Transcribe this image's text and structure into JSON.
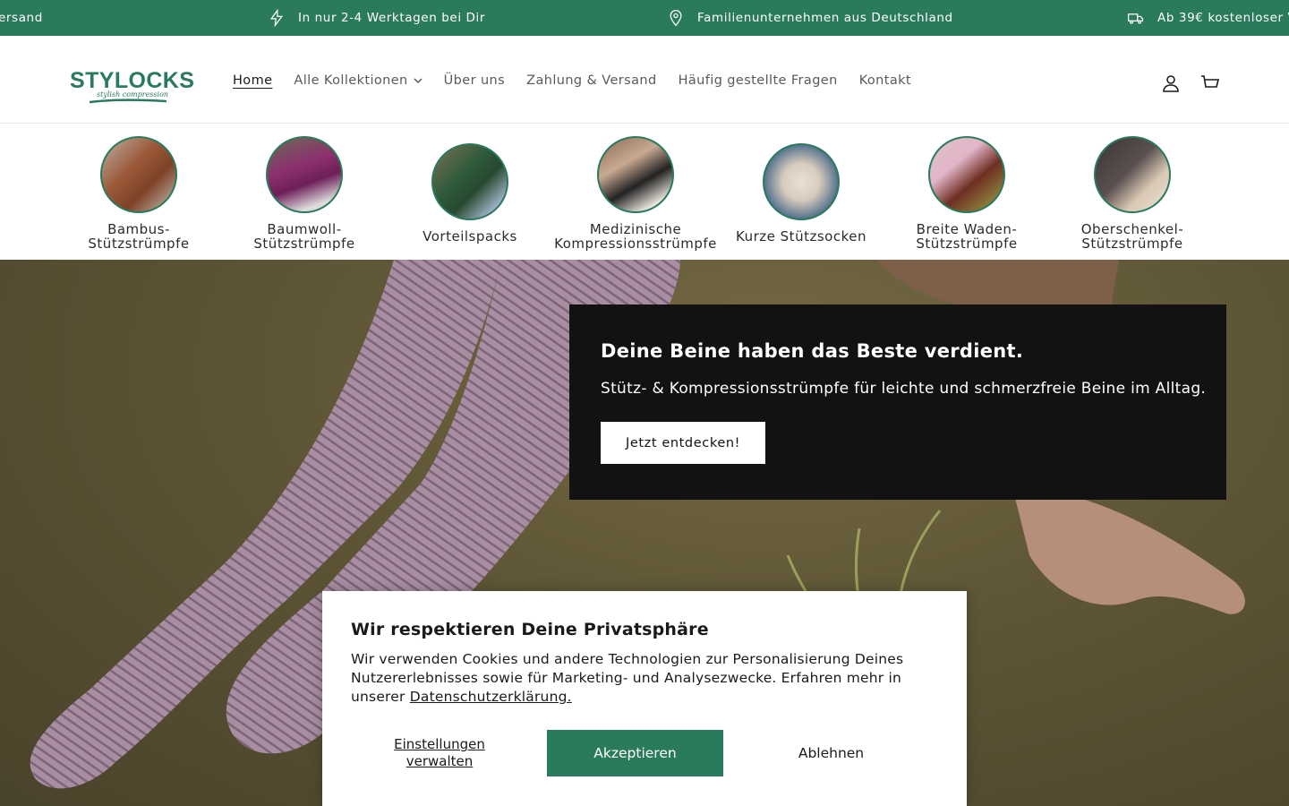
{
  "announcement": {
    "items": [
      {
        "icon": "truck-icon",
        "text": "ersand"
      },
      {
        "icon": "lightning-icon",
        "text": "In nur 2-4 Werktagen bei Dir"
      },
      {
        "icon": "map-pin-icon",
        "text": "Familienunternehmen aus Deutschland"
      },
      {
        "icon": "truck-icon",
        "text": "Ab 39€ kostenloser V"
      }
    ]
  },
  "header": {
    "logo_text": "STYLOCKS",
    "logo_tagline": "stylish compression",
    "nav": [
      {
        "label": "Home",
        "active": true
      },
      {
        "label": "Alle Kollektionen",
        "has_dropdown": true
      },
      {
        "label": "Über uns"
      },
      {
        "label": "Zahlung & Versand"
      },
      {
        "label": "Häufig gestellte Fragen"
      },
      {
        "label": "Kontakt"
      }
    ],
    "icons": [
      "account-icon",
      "cart-icon"
    ]
  },
  "categories": [
    {
      "line1": "Bambus-",
      "line2": "Stützstrümpfe"
    },
    {
      "line1": "Baumwoll-",
      "line2": "Stützstrümpfe"
    },
    {
      "line1": "Vorteilspacks",
      "line2": ""
    },
    {
      "line1": "Medizinische",
      "line2": "Kompressionsstrümpfe"
    },
    {
      "line1": "Kurze Stützsocken",
      "line2": ""
    },
    {
      "line1": "Breite Waden-",
      "line2": "Stützstrümpfe"
    },
    {
      "line1": "Oberschenkel-",
      "line2": "Stützstrümpfe"
    }
  ],
  "hero": {
    "title": "Deine Beine haben das Beste verdient.",
    "subtitle": "Stütz- & Kompressionsstrümpfe für leichte und schmerzfreie Beine im Alltag.",
    "cta": "Jetzt entdecken!"
  },
  "cookie": {
    "title": "Wir respektieren Deine Privatsphäre",
    "body": "Wir verwenden Cookies und andere Technologien zur Personalisierung Deines Nutzererlebnisses sowie für Marketing- und Analysezwecke. Erfahren mehr in unserer",
    "link": "Datenschutzerklärung.",
    "manage_line1": "Einstellungen",
    "manage_line2": "verwalten",
    "accept": "Akzeptieren",
    "decline": "Ablehnen"
  },
  "colors": {
    "brand_green": "#2a7a5c",
    "hero_box": "#121212"
  }
}
